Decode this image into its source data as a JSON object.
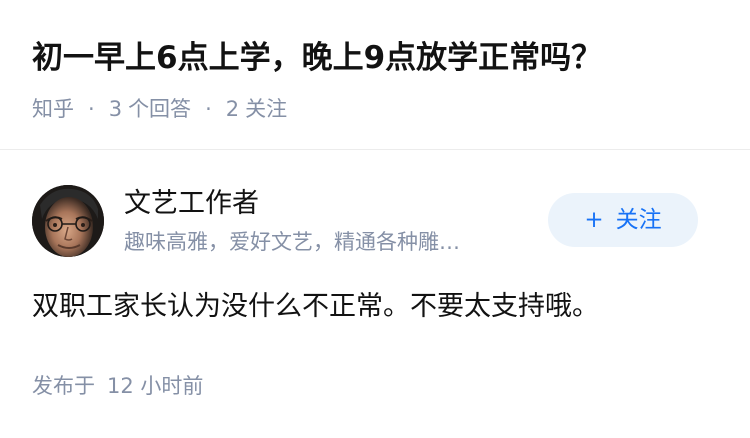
{
  "question": {
    "title": "初一早上6点上学，晚上9点放学正常吗？",
    "source": "知乎",
    "separator": "·",
    "answer_count": "3",
    "answer_label": "个回答",
    "follower_count": "2",
    "follower_label": "关注"
  },
  "answer": {
    "author": {
      "name": "文艺工作者",
      "bio": "趣味高雅，爱好文艺，精通各种雕…",
      "avatar": "author-portrait"
    },
    "follow_button": {
      "icon": "+",
      "label": "关注"
    },
    "content": "双职工家长认为没什么不正常。不要太支持哦。",
    "time_prefix": "发布于",
    "time_value": "12 小时前"
  },
  "colors": {
    "text_primary": "#121212",
    "text_secondary": "#8590a6",
    "accent": "#1772f6",
    "accent_bg": "#ebf3fb",
    "divider": "#ececec"
  }
}
